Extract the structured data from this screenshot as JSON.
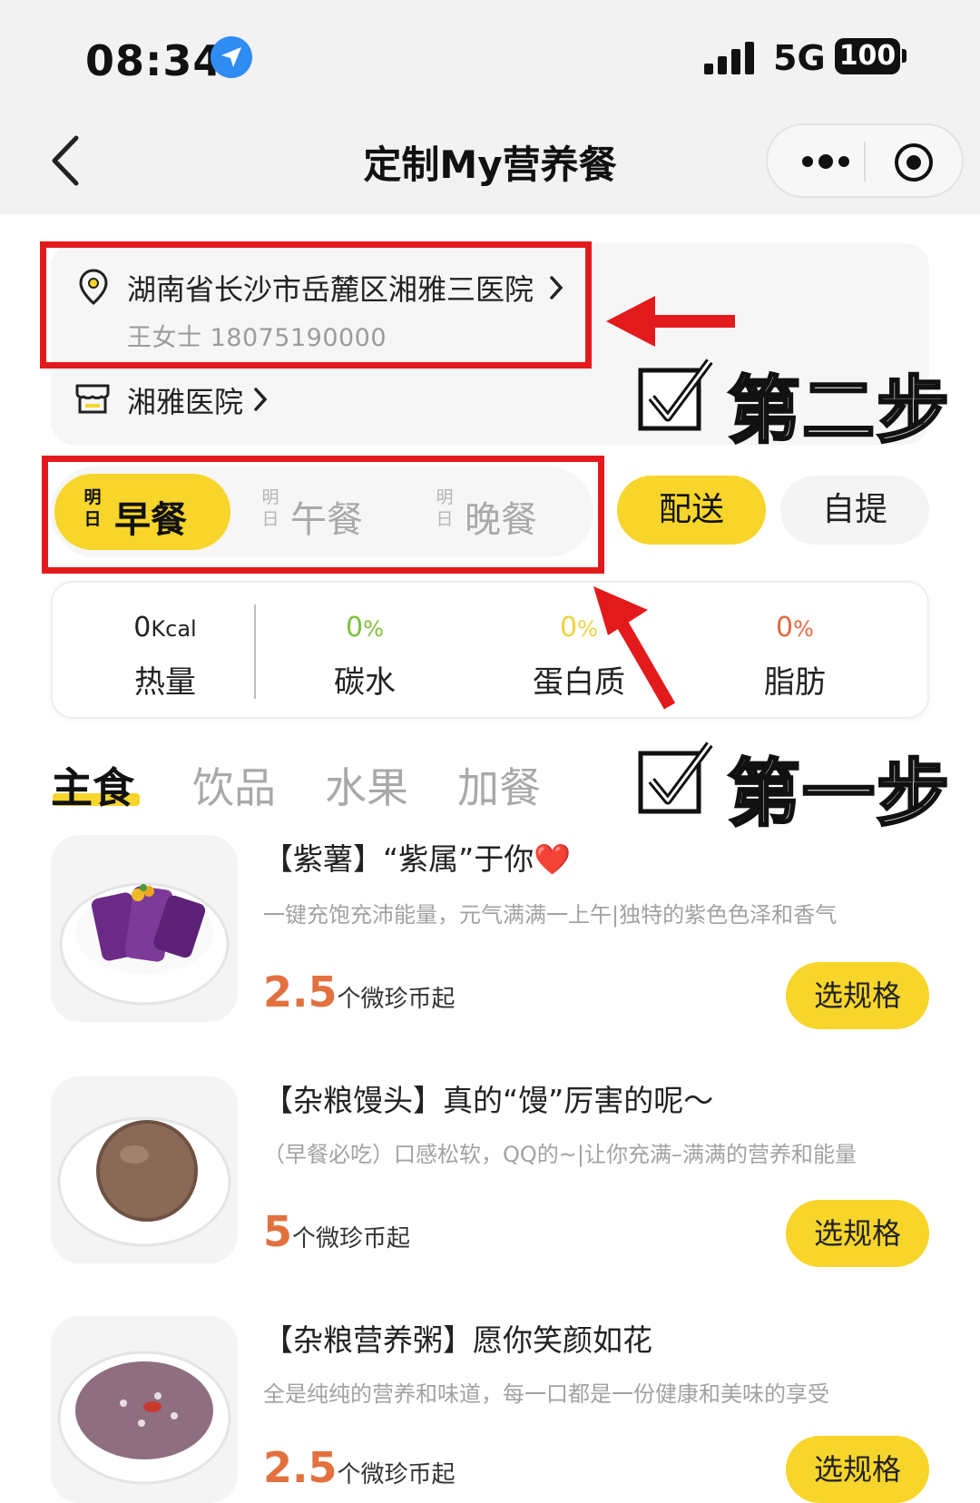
{
  "status_bar": {
    "time": "08:34",
    "network": "5G",
    "battery": "100"
  },
  "nav": {
    "title": "定制My营养餐"
  },
  "address": {
    "line": "湖南省长沙市岳麓区湘雅三医院",
    "contact": "王女士 18075190000",
    "store": "湘雅医院"
  },
  "meal_tabs": [
    {
      "day": "明日",
      "meal": "早餐",
      "active": true
    },
    {
      "day": "明日",
      "meal": "午餐",
      "active": false
    },
    {
      "day": "明日",
      "meal": "晚餐",
      "active": false
    }
  ],
  "delivery": {
    "delivery_label": "配送",
    "pickup_label": "自提",
    "selected": "配送"
  },
  "nutrition": [
    {
      "value": "0",
      "unit": "Kcal",
      "label": "热量",
      "color": "#222222"
    },
    {
      "value": "0",
      "unit": "%",
      "label": "碳水",
      "color": "#7cc23a"
    },
    {
      "value": "0",
      "unit": "%",
      "label": "蛋白质",
      "color": "#f0d23c"
    },
    {
      "value": "0",
      "unit": "%",
      "label": "脂肪",
      "color": "#e5683d"
    }
  ],
  "categories": [
    "主食",
    "饮品",
    "水果",
    "加餐"
  ],
  "active_category": "主食",
  "foods": [
    {
      "title": "【紫薯】“紫属”于你",
      "title_emoji": "❤️",
      "desc": "一键充饱充沛能量，元气满满一上午|独特的紫色色泽和香气",
      "price": "2.5",
      "price_unit": "个微珍币起",
      "button": "选规格"
    },
    {
      "title": "【杂粮馒头】真的“馒”厉害的呢～",
      "title_emoji": "",
      "desc": "（早餐必吃）口感松软，QQ的~|让你充满–满满的营养和能量",
      "price": "5",
      "price_unit": "个微珍币起",
      "button": "选规格"
    },
    {
      "title": "【杂粮营养粥】愿你笑颜如花",
      "title_emoji": "",
      "desc": "全是纯纯的营养和味道，每一口都是一份健康和美味的享受",
      "price": "2.5",
      "price_unit": "个微珍币起",
      "button": "选规格"
    }
  ],
  "annotations": {
    "step_two": "第二步",
    "step_one": "第一步"
  },
  "colors": {
    "accent_yellow": "#f7d52a",
    "price_orange": "#e2713f",
    "annotation_red": "#e31a1c"
  }
}
